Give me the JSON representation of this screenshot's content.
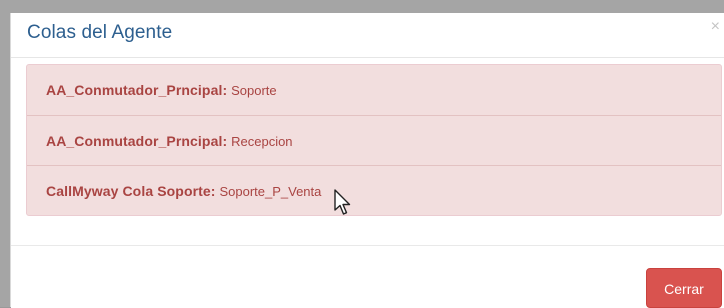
{
  "modal": {
    "title": "Colas del Agente",
    "close_glyph": "×",
    "close_icon": "close-icon"
  },
  "queues": [
    {
      "name": "AA_Conmutador_Prncipal:",
      "value": "Soporte"
    },
    {
      "name": "AA_Conmutador_Prncipal:",
      "value": "Recepcion"
    },
    {
      "name": "CallMyway Cola Soporte:",
      "value": "Soporte_P_Venta"
    }
  ],
  "footer": {
    "close_label": "Cerrar"
  },
  "colors": {
    "title": "#2d5f8f",
    "alert_bg": "#f2dede",
    "alert_text": "#a94442",
    "button_bg": "#d9534f"
  },
  "pointer_icon": "mouse-pointer-icon"
}
